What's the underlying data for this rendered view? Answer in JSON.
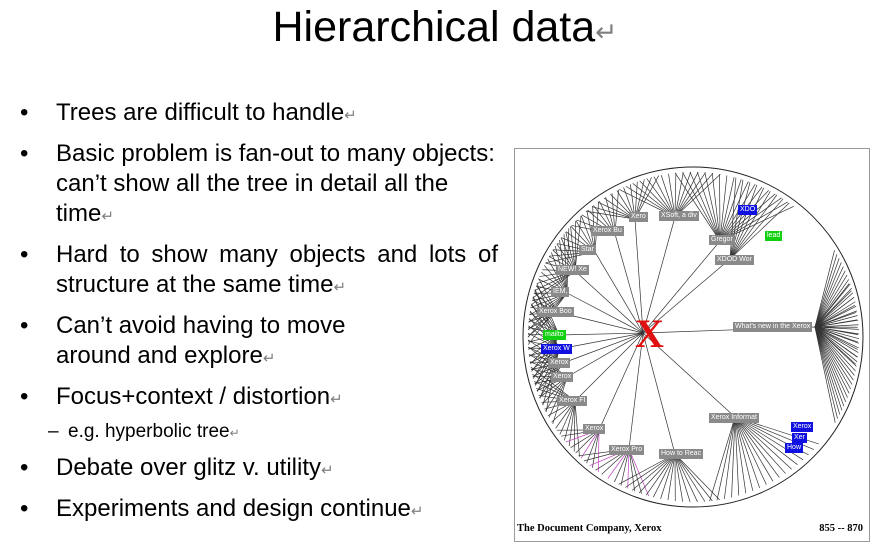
{
  "slide": {
    "title": "Hierarchical data",
    "return_mark": "↵",
    "bullets": [
      {
        "level": 1,
        "text": "Trees are difficult to handle"
      },
      {
        "level": 1,
        "text": "Basic problem is fan-out to many objects: can’t show all the tree in detail all the time"
      },
      {
        "level": 1,
        "text": "Hard to show many objects and lots of structure at the same time"
      },
      {
        "level": 1,
        "text": "Can’t avoid having to move around and explore"
      },
      {
        "level": 1,
        "text": "Focus+context / distortion"
      },
      {
        "level": 2,
        "text": "e.g. hyperbolic tree"
      },
      {
        "level": 1,
        "text": "Debate over glitz v. utility"
      },
      {
        "level": 1,
        "text": "Experiments and design continue"
      }
    ]
  },
  "figure": {
    "center_logo": "X",
    "caption_left": "The Document Company, Xerox",
    "caption_right": "855 -- 870",
    "nodes": [
      {
        "label": "Xerox Bu",
        "color": "gray"
      },
      {
        "label": "Xero",
        "color": "gray"
      },
      {
        "label": "XSoft, a div",
        "color": "gray"
      },
      {
        "label": "XDO",
        "color": "blue"
      },
      {
        "label": "Gregor",
        "color": "gray"
      },
      {
        "label": "lead",
        "color": "green"
      },
      {
        "label": "XDOD Wor",
        "color": "gray"
      },
      {
        "label": "Star",
        "color": "gray"
      },
      {
        "label": "NEW! Xe",
        "color": "gray"
      },
      {
        "label": "IEM,",
        "color": "gray"
      },
      {
        "label": "Xerox Boo",
        "color": "gray"
      },
      {
        "label": "What's new in the Xerox",
        "color": "gray"
      },
      {
        "label": "mailto",
        "color": "green"
      },
      {
        "label": "Xerox W",
        "color": "blue"
      },
      {
        "label": "Xerox",
        "color": "gray"
      },
      {
        "label": "Xerox",
        "color": "gray"
      },
      {
        "label": "Xerox FI",
        "color": "gray"
      },
      {
        "label": "Xerox Informat",
        "color": "gray"
      },
      {
        "label": "Xerox",
        "color": "blue"
      },
      {
        "label": "Xer",
        "color": "blue"
      },
      {
        "label": "How",
        "color": "blue"
      },
      {
        "label": "Xerox",
        "color": "gray"
      },
      {
        "label": "Xerox Pro",
        "color": "gray"
      },
      {
        "label": "How to Reac",
        "color": "gray"
      }
    ]
  }
}
